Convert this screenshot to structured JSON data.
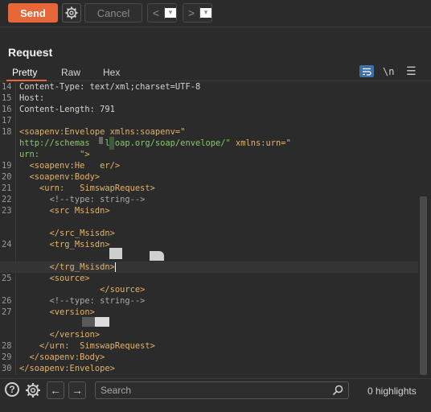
{
  "toolbar": {
    "send_label": "Send",
    "cancel_label": "Cancel",
    "back_glyph": "<",
    "forward_glyph": ">",
    "dropdown_glyph": "▾",
    "settings_icon": "gear-icon"
  },
  "panel": {
    "title": "Request",
    "tabs": [
      {
        "label": "Pretty",
        "active": true
      },
      {
        "label": "Raw",
        "active": false
      },
      {
        "label": "Hex",
        "active": false
      }
    ],
    "newline_toggle": "\\n"
  },
  "editor": {
    "lines": [
      {
        "n": "14",
        "parts": [
          {
            "t": "Content-Type: text/xml;charset=UTF-8",
            "c": "hdr"
          }
        ]
      },
      {
        "n": "15",
        "parts": [
          {
            "t": "Host: ",
            "c": "hdr"
          }
        ]
      },
      {
        "n": "16",
        "parts": [
          {
            "t": "Content-Length: 791",
            "c": "hdr"
          }
        ]
      },
      {
        "n": "17",
        "parts": []
      },
      {
        "n": "18",
        "parts": [
          {
            "t": "<soapenv:Envelope ",
            "c": "tag"
          },
          {
            "t": "xmlns:soapenv=\"",
            "c": "attr"
          }
        ]
      },
      {
        "n": "",
        "parts": [
          {
            "t": "http://schemas   lsoap.org/soap/envelope/\"",
            "c": "val"
          },
          {
            "t": " xmlns:urn=\"",
            "c": "attr"
          }
        ]
      },
      {
        "n": "",
        "parts": [
          {
            "t": "urn:        \"",
            "c": "val"
          },
          {
            "t": ">",
            "c": "tag"
          }
        ]
      },
      {
        "n": "19",
        "parts": [
          {
            "t": "  <soapenv:He   er/>",
            "c": "tag"
          }
        ]
      },
      {
        "n": "20",
        "parts": [
          {
            "t": "  <soapenv:Body>",
            "c": "tag"
          }
        ]
      },
      {
        "n": "21",
        "parts": [
          {
            "t": "    <urn:   SimswapRequest>",
            "c": "tag"
          }
        ]
      },
      {
        "n": "22",
        "parts": [
          {
            "t": "      <!--type: string-->",
            "c": "cmt"
          }
        ]
      },
      {
        "n": "23",
        "parts": [
          {
            "t": "      <src Msisdn>",
            "c": "tag"
          }
        ]
      },
      {
        "n": "",
        "parts": []
      },
      {
        "n": "",
        "parts": [
          {
            "t": "      </src_Msisdn>",
            "c": "tag"
          }
        ]
      },
      {
        "n": "24",
        "parts": [
          {
            "t": "      <trg_Msisdn>",
            "c": "tag"
          }
        ]
      },
      {
        "n": "",
        "parts": []
      },
      {
        "n": "",
        "parts": [
          {
            "t": "      </trg_Msisdn>",
            "c": "tag"
          }
        ],
        "current": true
      },
      {
        "n": "25",
        "parts": [
          {
            "t": "      <source>",
            "c": "tag"
          }
        ]
      },
      {
        "n": "",
        "parts": [
          {
            "t": "                </source>",
            "c": "tag"
          }
        ]
      },
      {
        "n": "26",
        "parts": [
          {
            "t": "      <!--type: string-->",
            "c": "cmt"
          }
        ]
      },
      {
        "n": "27",
        "parts": [
          {
            "t": "      <version>",
            "c": "tag"
          }
        ]
      },
      {
        "n": "",
        "parts": []
      },
      {
        "n": "",
        "parts": [
          {
            "t": "      </version>",
            "c": "tag"
          }
        ]
      },
      {
        "n": "28",
        "parts": [
          {
            "t": "    </urn:  SimswapRequest>",
            "c": "tag"
          }
        ]
      },
      {
        "n": "29",
        "parts": [
          {
            "t": "  </soapenv:Body>",
            "c": "tag"
          }
        ]
      },
      {
        "n": "30",
        "parts": [
          {
            "t": "</soapenv:Envelope>",
            "c": "tag"
          }
        ]
      }
    ]
  },
  "search": {
    "placeholder": "Search",
    "value": "",
    "highlights": "0 highlights"
  },
  "colors": {
    "accent": "#e8673a",
    "tag": "#e3b36b",
    "value": "#88c76a",
    "comment": "#a8a8a8",
    "wrap_toggle": "#3d6fa8"
  }
}
